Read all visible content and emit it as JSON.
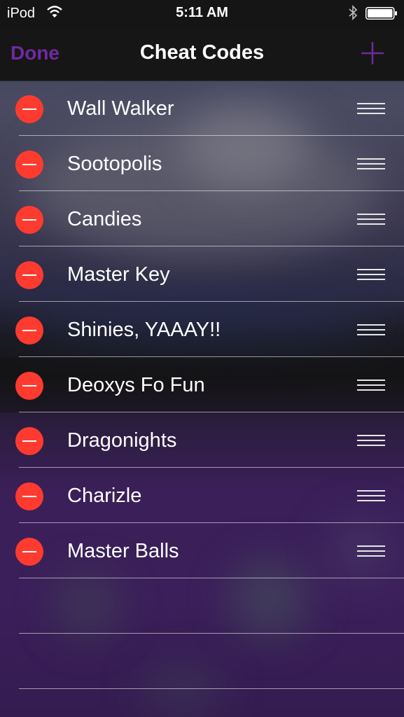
{
  "status_bar": {
    "carrier": "iPod",
    "time": "5:11 AM",
    "wifi_icon": "wifi-icon",
    "bluetooth_icon": "bluetooth-icon",
    "battery_icon": "battery-icon",
    "battery_level": 1.0
  },
  "nav": {
    "done_label": "Done",
    "title": "Cheat Codes",
    "add_icon": "plus-icon",
    "accent_color": "#6f2aa0"
  },
  "list": {
    "delete_icon": "minus-circle-icon",
    "reorder_icon": "reorder-grip-icon",
    "delete_color": "#ff3b30",
    "items": [
      {
        "label": "Wall Walker"
      },
      {
        "label": "Sootopolis"
      },
      {
        "label": "Candies"
      },
      {
        "label": "Master Key"
      },
      {
        "label": "Shinies, YAAAY!!"
      },
      {
        "label": "Deoxys Fo Fun"
      },
      {
        "label": "Dragonights"
      },
      {
        "label": "Charizle"
      },
      {
        "label": "Master Balls"
      }
    ]
  }
}
